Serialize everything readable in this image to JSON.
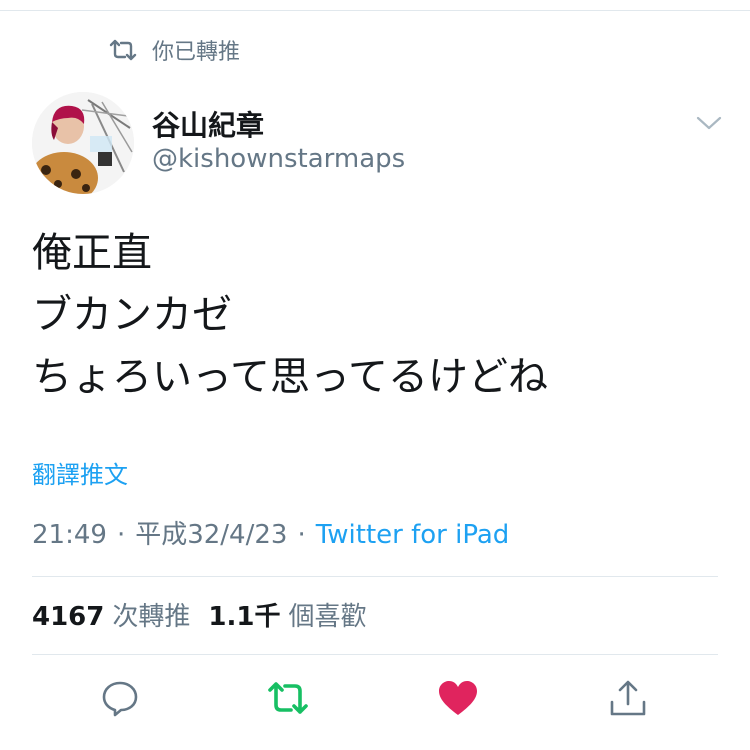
{
  "retweet_banner": {
    "text": "你已轉推",
    "icon": "retweet-icon"
  },
  "author": {
    "display_name": "谷山紀章",
    "handle": "@kishownstarmaps",
    "avatar": "avatar-image"
  },
  "tweet": {
    "lines": [
      "俺正直",
      "ブカンカゼ",
      "ちょろいって思ってるけどね"
    ],
    "translate_label": "翻譯推文"
  },
  "meta": {
    "time": "21:49",
    "separator": "·",
    "date": "平成32/4/23",
    "source": "Twitter for iPad"
  },
  "stats": {
    "retweets_value": "4167",
    "retweets_label": "次轉推",
    "likes_value": "1.1千",
    "likes_label": "個喜歡"
  },
  "actions": [
    {
      "name": "reply",
      "icon": "reply-icon",
      "color": "#657786"
    },
    {
      "name": "retweet",
      "icon": "retweet-icon",
      "color": "#17bf63",
      "active": true
    },
    {
      "name": "like",
      "icon": "heart-icon",
      "color": "#e0245e",
      "active": true
    },
    {
      "name": "share",
      "icon": "share-icon",
      "color": "#657786"
    }
  ],
  "colors": {
    "link": "#1da1f2",
    "secondary_text": "#657786",
    "primary_text": "#14171a",
    "retweet_active": "#17bf63",
    "like_active": "#e0245e",
    "divider": "#e1e8ed"
  }
}
